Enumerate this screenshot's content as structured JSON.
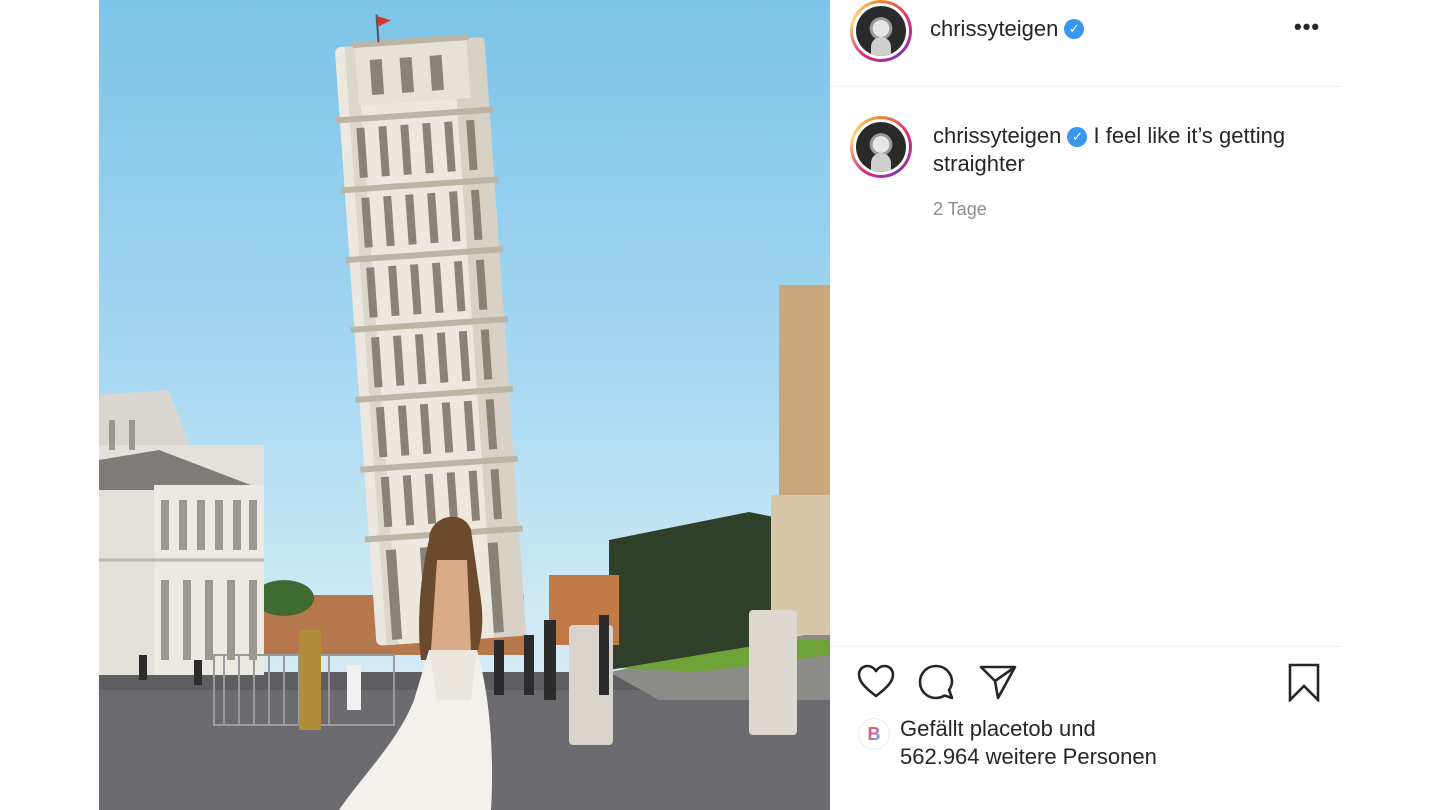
{
  "post": {
    "username": "chrissyteigen",
    "verified_mark": "✓",
    "more_label": "•••",
    "caption": "I feel like it’s getting straighter",
    "time": "2 Tage",
    "likes": {
      "prefix": "Gefällt",
      "user": "placetob",
      "joiner": "und",
      "rest": "562.964 weitere Personen",
      "mini_avatar_letter": "B"
    }
  },
  "icons": {
    "like": "heart-icon",
    "comment": "comment-icon",
    "share": "paper-plane-icon",
    "save": "bookmark-icon",
    "verified": "verified-badge-icon"
  },
  "colors": {
    "verified_blue": "#3897f0",
    "meta_gray": "#8e8e8e",
    "text": "#262626"
  }
}
